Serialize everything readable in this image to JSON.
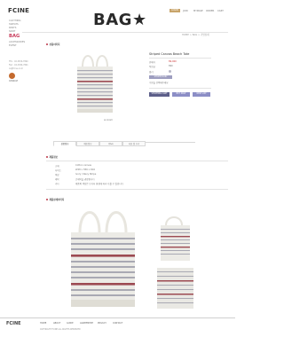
{
  "brand": {
    "logo": "FCINE"
  },
  "sidebar": {
    "items": [
      {
        "label": "CLOTHING",
        "top": 0
      },
      {
        "label": "SWEATS"
      },
      {
        "label": "PANTS"
      },
      {
        "label": "SKIRT"
      },
      {
        "label": "BAG"
      },
      {
        "label": "ACCESSORIES"
      },
      {
        "label": "EVENT"
      }
    ],
    "info_lines": [
      "TEL : 02-3456-7890",
      "FAX : 02-3456-7891",
      "cs@fcine.co.kr"
    ],
    "promo_label": "CONSULT"
  },
  "header": {
    "title": "BAG",
    "login": "LOGIN",
    "nav": [
      "JOIN",
      "MYPAGE",
      "ORDER",
      "CART"
    ]
  },
  "breadcrumb": "HOME > BAG > 가방상세",
  "sections": {
    "product_image": "상품이미지",
    "product_info": "제품정보",
    "detail_image": "제품상세이미지"
  },
  "product": {
    "name": "Striped Canvas Beach Tote",
    "price_label": "판매가",
    "price": "89,000",
    "point_label": "적립금",
    "point": "890",
    "option_label": "컬러",
    "option_value": "STRIPE/IVORY",
    "qty_note": "수량을 선택해주세요",
    "zoom_label": "zoom",
    "color_hex": "#b8b8c8",
    "buttons": [
      "SHOPPING CART",
      "BUY NOW",
      "WISH LIST"
    ]
  },
  "tabs": [
    "상품정보",
    "배송정보",
    "Q&A",
    "리뷰 및 후기"
  ],
  "info_rows": [
    {
      "label": "소재",
      "value": "Cotton canvas"
    },
    {
      "label": "사이즈",
      "value": "W48 x H36 x D16"
    },
    {
      "label": "색상",
      "value": "Ivory / Navy Stripe"
    },
    {
      "label": "세탁",
      "value": "손세탁을 권장합니다"
    },
    {
      "label": "기타",
      "value": "제품의 색상은 모니터 환경에 따라 다를 수 있습니다"
    }
  ],
  "footer": {
    "logo": "FCINE",
    "nav": [
      "HOME",
      "ABOUT",
      "GUIDE",
      "AGREEMENT",
      "PRIVACY",
      "CONTACT"
    ],
    "address": "COPYRIGHT FCINE ALL RIGHTS RESERVED"
  }
}
